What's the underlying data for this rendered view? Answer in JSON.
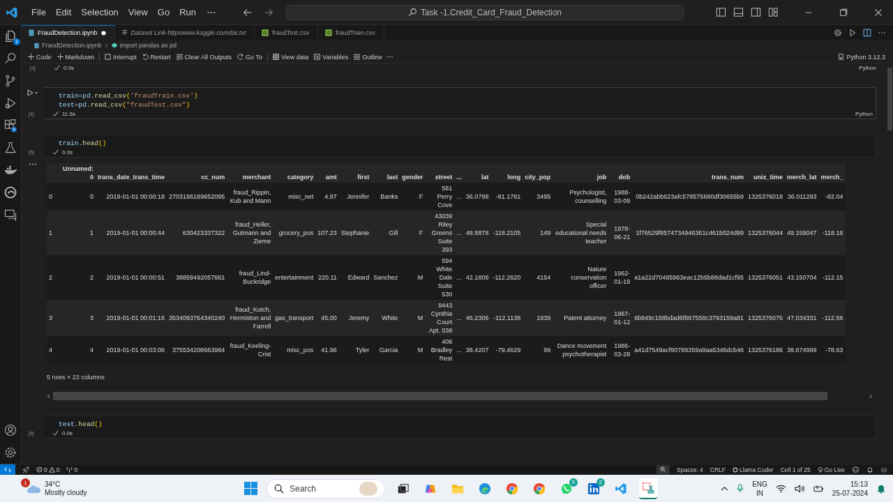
{
  "title_bar": {
    "menu": [
      "File",
      "Edit",
      "Selection",
      "View",
      "Go",
      "Run"
    ],
    "search": "Task -1.Credit_Card_Fraud_Detection"
  },
  "activity_bar": {
    "explorer_badge": "1"
  },
  "tabs": [
    {
      "label": "FraudDetection.ipynb",
      "kind": "notebook",
      "selected": true,
      "dirty": true,
      "preview": false
    },
    {
      "label": "Dataset Link-httpswww.kaggle.comdat.txt",
      "kind": "text",
      "selected": false,
      "dirty": false,
      "preview": true
    },
    {
      "label": "fraudTest.csv",
      "kind": "csv",
      "selected": false,
      "dirty": false,
      "preview": false
    },
    {
      "label": "fraudTrain.csv",
      "kind": "csv",
      "selected": false,
      "dirty": false,
      "preview": false
    }
  ],
  "breadcrumb": [
    "FraudDetection.ipynb",
    "import pandas as pd"
  ],
  "toolbar": [
    [
      {
        "kind": "add",
        "label": "Code"
      },
      {
        "kind": "add",
        "label": "Markdown"
      }
    ],
    [
      {
        "kind": "interrupt",
        "label": "Interrupt"
      },
      {
        "kind": "restart",
        "label": "Restart"
      },
      {
        "kind": "clear",
        "label": "Clear All Outputs"
      },
      {
        "kind": "goto",
        "label": "Go To"
      }
    ],
    [
      {
        "kind": "data",
        "label": "View data"
      },
      {
        "kind": "variables",
        "label": "Variables"
      },
      {
        "kind": "outline",
        "label": "Outline"
      }
    ]
  ],
  "kernel": "Python 3.12.3",
  "cells": [
    {
      "kind": "tail",
      "count": "[3]",
      "time": "0.0s",
      "language": "Python"
    },
    {
      "kind": "code",
      "count": "[4]",
      "time": "11.5s",
      "language": "Python",
      "run_button": true,
      "lines": [
        [
          {
            "kind": "var",
            "text": "train"
          },
          {
            "kind": "op",
            "text": "="
          },
          {
            "kind": "var",
            "text": "pd"
          },
          {
            "kind": "op",
            "text": "."
          },
          {
            "kind": "func",
            "text": "read_csv"
          },
          {
            "kind": "punc",
            "text": "("
          },
          {
            "kind": "str",
            "text": "'fraudTrain.csv'"
          },
          {
            "kind": "punc",
            "text": ")"
          }
        ],
        [
          {
            "kind": "var",
            "text": "test"
          },
          {
            "kind": "op",
            "text": "="
          },
          {
            "kind": "var",
            "text": "pd"
          },
          {
            "kind": "op",
            "text": "."
          },
          {
            "kind": "func",
            "text": "read_csv"
          },
          {
            "kind": "punc",
            "text": "("
          },
          {
            "kind": "str",
            "text": "\"fraudTest.csv\""
          },
          {
            "kind": "punc",
            "text": ")"
          }
        ]
      ]
    },
    {
      "kind": "code",
      "count": "[5]",
      "time": "0.0s",
      "run_button": false,
      "lines": [
        [
          {
            "kind": "var",
            "text": "train"
          },
          {
            "kind": "op",
            "text": "."
          },
          {
            "kind": "func",
            "text": "head"
          },
          {
            "kind": "punc",
            "text": "()"
          }
        ]
      ],
      "output": {
        "columns": [
          "Unnamed: 0",
          "trans_date_trans_time",
          "cc_num",
          "merchant",
          "category",
          "amt",
          "first",
          "last",
          "gender",
          "street",
          "...",
          "lat",
          "long",
          "city_pop",
          "job",
          "dob",
          "trans_num",
          "unix_time",
          "merch_lat",
          "merch_"
        ],
        "rows": [
          {
            "index": "0",
            "cells": [
              "0",
              "2019-01-01 00:00:18",
              "2703186189652095",
              "fraud_Rippin, Kub and Mann",
              "misc_net",
              "4.97",
              "Jennifer",
              "Banks",
              "F",
              "561 Perry Cove",
              "...",
              "36.0788",
              "-81.1781",
              "3495",
              "Psychologist, counselling",
              "1988-03-09",
              "0b242abb623afc578575680df30655b9",
              "1325376018",
              "36.011293",
              "-82.04"
            ]
          },
          {
            "index": "1",
            "cells": [
              "1",
              "2019-01-01 00:00:44",
              "630423337322",
              "fraud_Heller, Gutmann and Zieme",
              "grocery_pos",
              "107.23",
              "Stephanie",
              "Gill",
              "F",
              "43039 Riley Greens Suite 393",
              "...",
              "48.8878",
              "-118.2105",
              "149",
              "Special educational needs teacher",
              "1978-06-21",
              "1f76529f8574734946361c461b024d99",
              "1325376044",
              "49.159047",
              "-118.18"
            ]
          },
          {
            "index": "2",
            "cells": [
              "2",
              "2019-01-01 00:00:51",
              "38859492057661",
              "fraud_Lind-Buckridge",
              "entertainment",
              "220.11",
              "Edward",
              "Sanchez",
              "M",
              "594 White Dale Suite 530",
              "...",
              "42.1808",
              "-112.2620",
              "4154",
              "Nature conservation officer",
              "1962-01-19",
              "a1a22d70485983eac12b5b88dad1cf95",
              "1325376051",
              "43.150704",
              "-112.15"
            ]
          },
          {
            "index": "3",
            "cells": [
              "3",
              "2019-01-01 00:01:16",
              "3534093764340240",
              "fraud_Kutch, Hermiston and Farrell",
              "gas_transport",
              "45.00",
              "Jeremy",
              "White",
              "M",
              "9443 Cynthia Court Apt. 038",
              "...",
              "46.2306",
              "-112.1138",
              "1939",
              "Patent attorney",
              "1967-01-12",
              "6b849c168bdad6f867558c3793159a81",
              "1325376076",
              "47.034331",
              "-112.56"
            ]
          },
          {
            "index": "4",
            "cells": [
              "4",
              "2019-01-01 00:03:06",
              "375534208663984",
              "fraud_Keeling-Crist",
              "misc_pos",
              "41.96",
              "Tyler",
              "Garcia",
              "M",
              "408 Bradley Rest",
              "...",
              "38.4207",
              "-79.4629",
              "99",
              "Dance movement psychotherapist",
              "1986-03-28",
              "a41d7549acf90789359a9aa5346dcb46",
              "1325376186",
              "38.674999",
              "-78.63"
            ]
          }
        ],
        "shape": "5 rows × 23 columns"
      }
    },
    {
      "kind": "code",
      "count": "[6]",
      "time": "0.0s",
      "run_button": false,
      "lines": [
        [
          {
            "kind": "var",
            "text": "test"
          },
          {
            "kind": "op",
            "text": "."
          },
          {
            "kind": "func",
            "text": "head"
          },
          {
            "kind": "punc",
            "text": "()"
          }
        ]
      ]
    }
  ],
  "status_bar": {
    "errors": "0",
    "warnings": "0",
    "ports": "0",
    "items": [
      {
        "kind": "text",
        "label": "Spaces: 4"
      },
      {
        "kind": "text",
        "label": "CRLF"
      },
      {
        "kind": "llama",
        "label": "Llama Coder"
      },
      {
        "kind": "text",
        "label": "Cell 1 of 25"
      },
      {
        "kind": "golive",
        "label": "Go Live"
      }
    ]
  },
  "taskbar": {
    "weather": {
      "badge": "1",
      "temp": "34°C",
      "condition": "Mostly cloudy"
    },
    "search": "Search",
    "apps": [
      {
        "kind": "taskview",
        "selected": false
      },
      {
        "kind": "copilot",
        "selected": false
      },
      {
        "kind": "files",
        "selected": false
      },
      {
        "kind": "edge",
        "selected": false
      },
      {
        "kind": "chrome",
        "selected": false
      },
      {
        "kind": "chrome",
        "selected": false
      },
      {
        "kind": "whatsapp",
        "badge": "5",
        "selected": false
      },
      {
        "kind": "linkedin",
        "badge": "2",
        "selected": false
      },
      {
        "kind": "vscode",
        "selected": false
      },
      {
        "kind": "snip",
        "selected": true
      }
    ],
    "tray": {
      "lang": "ENG",
      "region": "IN",
      "time": "15:13",
      "date": "25-07-2024"
    }
  }
}
